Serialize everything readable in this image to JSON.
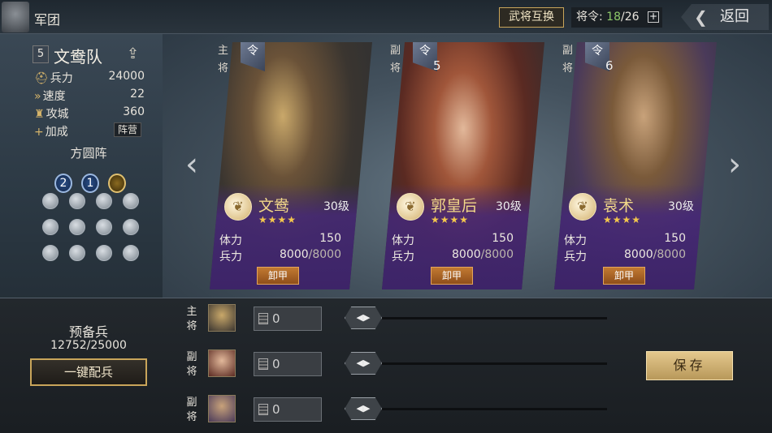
{
  "header": {
    "title": "军团",
    "swap_label": "武将互换",
    "order_label": "将令:",
    "order_current": "18",
    "order_total": "/26",
    "order_plus": "+",
    "back_label": "返回"
  },
  "team": {
    "level": "5",
    "name": "文鸯队",
    "stats": [
      {
        "icon": "helmet-icon",
        "glyph": "⛑",
        "label": "兵力",
        "value": "24000"
      },
      {
        "icon": "speed-icon",
        "glyph": "»",
        "label": "速度",
        "value": "22"
      },
      {
        "icon": "siege-icon",
        "glyph": "♜",
        "label": "攻城",
        "value": "360"
      }
    ],
    "bonus_label": "加成",
    "bonus_glyph": "+",
    "bonus_tag": "阵营",
    "formation": "方圆阵",
    "badges": [
      "2",
      "1"
    ]
  },
  "generals": [
    {
      "role": "主将",
      "cost": "",
      "name": "文鸯",
      "level": "30级",
      "stars": "★★★★",
      "stamina_label": "体力",
      "stamina": "150",
      "troops_label": "兵力",
      "troops": "8000",
      "troops_max": "/8000",
      "unequip": "卸甲",
      "ling": "令",
      "emblem": "❦"
    },
    {
      "role": "副将",
      "cost": "5",
      "name": "郭皇后",
      "level": "30级",
      "stars": "★★★★",
      "stamina_label": "体力",
      "stamina": "150",
      "troops_label": "兵力",
      "troops": "8000",
      "troops_max": "/8000",
      "unequip": "卸甲",
      "ling": "令",
      "emblem": "❦"
    },
    {
      "role": "副将",
      "cost": "6",
      "name": "袁术",
      "level": "30级",
      "stars": "★★★★",
      "stamina_label": "体力",
      "stamina": "150",
      "troops_label": "兵力",
      "troops": "8000",
      "troops_max": "/8000",
      "unequip": "卸甲",
      "ling": "令",
      "emblem": "❦"
    }
  ],
  "reserve": {
    "title": "预备兵",
    "count": "12752/25000",
    "auto_label": "一键配兵"
  },
  "allocation": [
    {
      "role": "主将",
      "value": "0",
      "handle": "◀▶"
    },
    {
      "role": "副将",
      "value": "0",
      "handle": "◀▶"
    },
    {
      "role": "副将",
      "value": "0",
      "handle": "◀▶"
    }
  ],
  "save_label": "保存",
  "colors": {
    "accent_gold": "#c9a55a",
    "card_purple": "#3d2468",
    "name_gold": "#f1d789"
  }
}
